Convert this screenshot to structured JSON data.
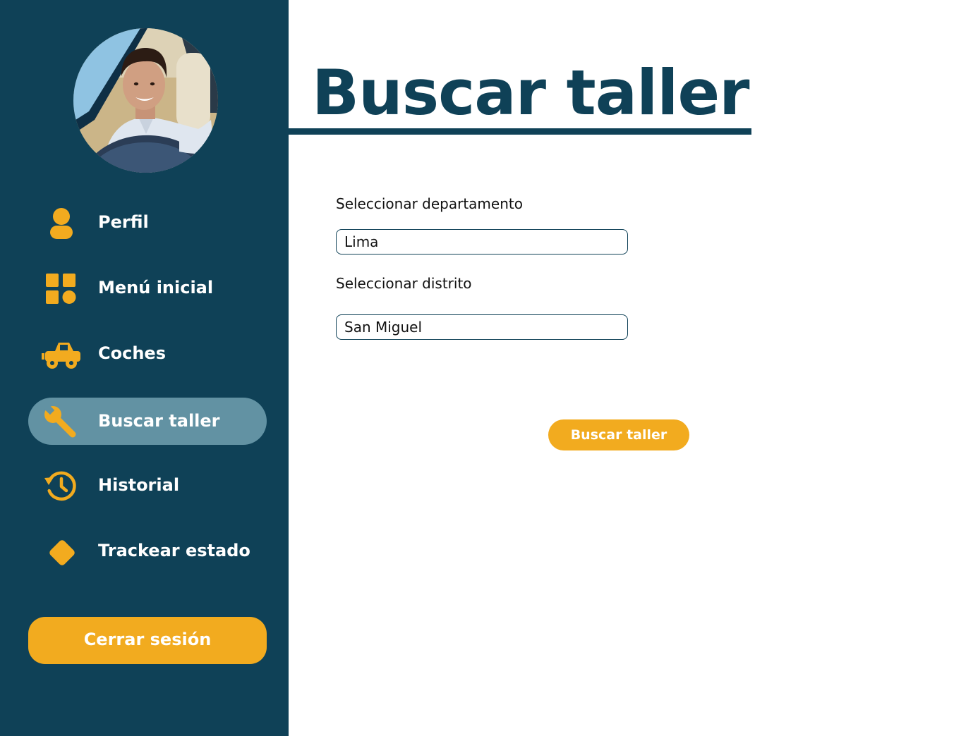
{
  "colors": {
    "sidebar_bg": "#0f4157",
    "accent": "#f2ab1f",
    "active_item_bg": "#6292a3",
    "title": "#0f4157"
  },
  "sidebar": {
    "avatar": {
      "icon": "user-avatar-photo"
    },
    "items": [
      {
        "label": "Perfil",
        "icon": "person-icon",
        "active": false
      },
      {
        "label": "Menú inicial",
        "icon": "grid-icon",
        "active": false
      },
      {
        "label": "Coches",
        "icon": "car-icon",
        "active": false
      },
      {
        "label": "Buscar taller",
        "icon": "wrench-icon",
        "active": true
      },
      {
        "label": "Historial",
        "icon": "history-icon",
        "active": false
      },
      {
        "label": "Trackear estado",
        "icon": "diamond-icon",
        "active": false
      }
    ],
    "logout_label": "Cerrar sesión"
  },
  "main": {
    "title": "Buscar taller",
    "department": {
      "label": "Seleccionar departamento",
      "value": "Lima"
    },
    "district": {
      "label": "Seleccionar distrito",
      "value": "San Miguel"
    },
    "search_button_label": "Buscar taller"
  }
}
